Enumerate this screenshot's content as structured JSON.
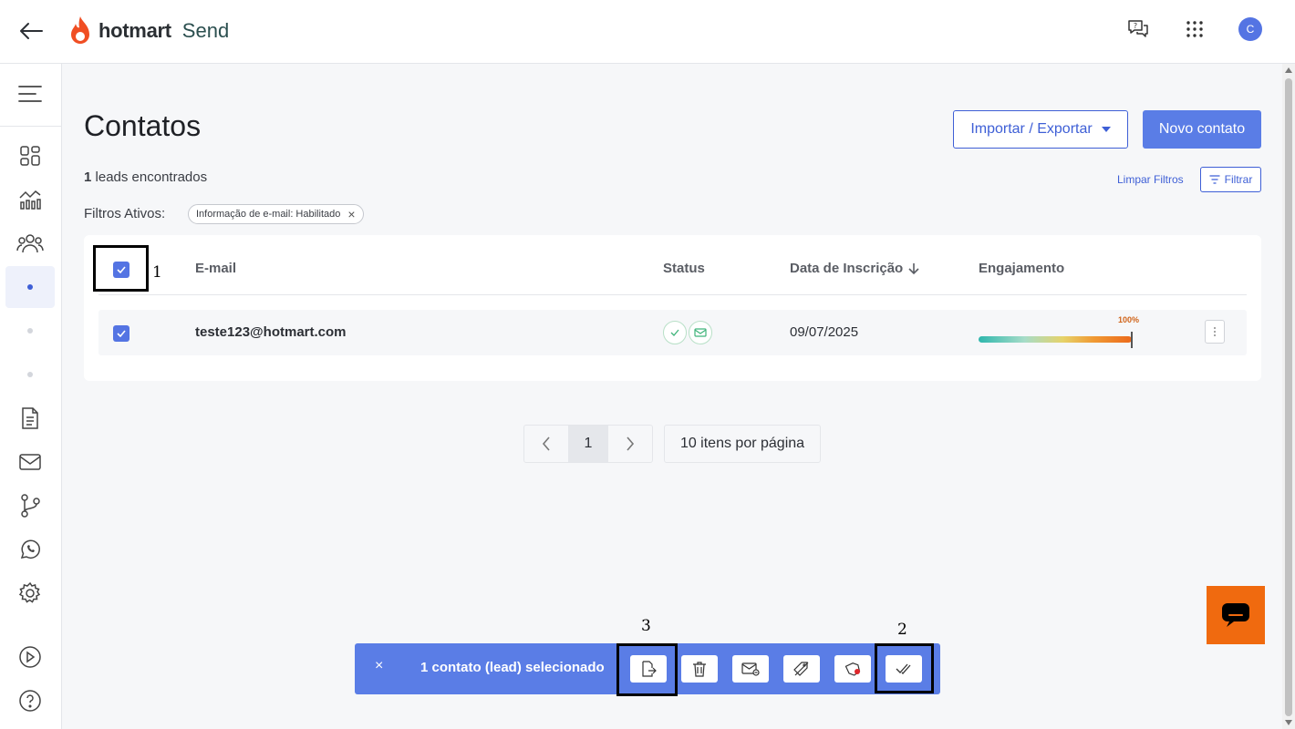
{
  "brand": {
    "logo_text": "hotmart",
    "product": "Send",
    "accent": "#5a7de6",
    "flame_color": "#f04e23"
  },
  "topbar": {
    "avatar_initial": "C",
    "icons": [
      "chat-help-icon",
      "apps-grid-icon"
    ]
  },
  "sidebar": {
    "items": [
      "dashboard-icon",
      "analytics-icon",
      "contacts-icon",
      "subitem-dot-1",
      "subitem-dot-2",
      "subitem-dot-3",
      "document-icon",
      "email-icon",
      "automation-icon",
      "whatsapp-icon",
      "settings-icon",
      "play-icon",
      "help-icon"
    ]
  },
  "page": {
    "title": "Contatos",
    "import_export_label": "Importar / Exportar",
    "new_contact_label": "Novo contato",
    "leads_count": "1",
    "leads_suffix": "leads encontrados",
    "clear_filters_label": "Limpar Filtros",
    "filter_label": "Filtrar",
    "active_filters_label": "Filtros Ativos:",
    "filter_chip": "Informação de e-mail: Habilitado"
  },
  "table": {
    "headers": {
      "email": "E-mail",
      "status": "Status",
      "date": "Data de Inscrição",
      "engagement": "Engajamento"
    },
    "rows": [
      {
        "email": "teste123@hotmart.com",
        "date": "09/07/2025",
        "engagement_label": "100%",
        "engagement": 1.0
      }
    ]
  },
  "pagination": {
    "current_page": "1",
    "per_page_label": "10 itens por página"
  },
  "action_bar": {
    "close": "×",
    "selected_text": "1 contato (lead) selecionado",
    "buttons": [
      "export-icon",
      "trash-icon",
      "email-settings-icon",
      "remove-tag-icon",
      "add-tag-icon",
      "double-check-icon"
    ]
  },
  "annotations": {
    "a1": "1",
    "a2": "2",
    "a3": "3"
  }
}
